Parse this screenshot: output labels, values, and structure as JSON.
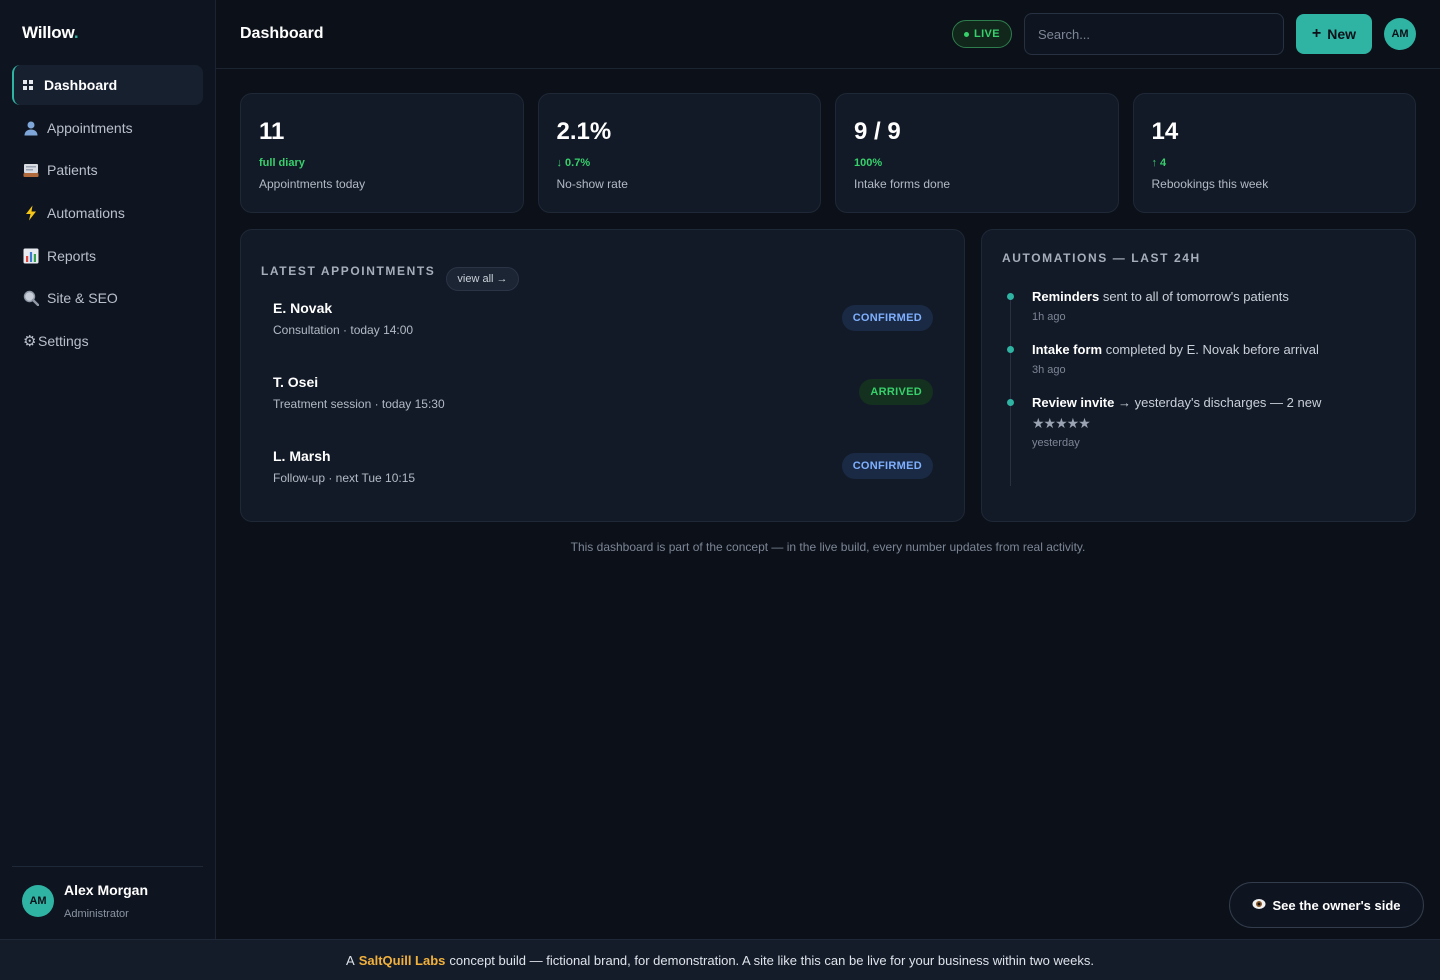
{
  "brand": {
    "name": "Willow",
    "dot": "."
  },
  "sidebar": {
    "items": [
      {
        "label": "Dashboard",
        "icon": "grid-icon"
      },
      {
        "label": "Appointments",
        "icon": "person-icon"
      },
      {
        "label": "Patients",
        "icon": "card-file-icon"
      },
      {
        "label": "Automations",
        "icon": "lightning-icon"
      },
      {
        "label": "Reports",
        "icon": "bar-chart-icon"
      },
      {
        "label": "Site & SEO",
        "icon": "magnifier-icon"
      },
      {
        "label": "Settings",
        "icon": "gear-icon"
      }
    ],
    "user": {
      "initials": "AM",
      "name": "Alex Morgan",
      "role": "Administrator"
    }
  },
  "header": {
    "title": "Dashboard",
    "live": "LIVE",
    "search_placeholder": "Search...",
    "new_label": "New",
    "avatar_initials": "AM"
  },
  "stats": [
    {
      "value": "11",
      "delta": "full diary",
      "label": "Appointments today"
    },
    {
      "value": "2.1%",
      "delta": "↓ 0.7%",
      "label": "No-show rate"
    },
    {
      "value": "9 / 9",
      "delta": "100%",
      "label": "Intake forms done"
    },
    {
      "value": "14",
      "delta": "↑ 4",
      "label": "Rebookings this week"
    }
  ],
  "appointments": {
    "title": "LATEST APPOINTMENTS",
    "view_all": "view all →",
    "rows": [
      {
        "name": "E. Novak",
        "detail": "Consultation · today 14:00",
        "status": "CONFIRMED"
      },
      {
        "name": "T. Osei",
        "detail": "Treatment session · today 15:30",
        "status": "ARRIVED"
      },
      {
        "name": "L. Marsh",
        "detail": "Follow-up · next Tue 10:15",
        "status": "CONFIRMED"
      }
    ]
  },
  "automations": {
    "title": "AUTOMATIONS — LAST 24H",
    "items": [
      {
        "bold": "Reminders",
        "text": " sent to all of tomorrow's patients",
        "time": "1h ago"
      },
      {
        "bold": "Intake form",
        "text": " completed by E. Novak before arrival",
        "time": "3h ago"
      },
      {
        "bold": "Review invite",
        "text": " → yesterday's discharges — 2 new",
        "stars": "★★★★★",
        "time": "yesterday"
      }
    ]
  },
  "footnote": "This dashboard is part of the concept — in the live build, every number updates from real activity.",
  "owner_button": "See the owner's side",
  "banner": {
    "prefix": "A",
    "brand": "SaltQuill Labs",
    "suffix": "concept build — fictional brand, for demonstration. A site like this can be live for your business within two weeks."
  },
  "colors": {
    "accent": "#2fb3a3",
    "live_green": "#37d06b",
    "confirmed_blue": "#7fb0ff",
    "banner_brand": "#f2b13c"
  }
}
